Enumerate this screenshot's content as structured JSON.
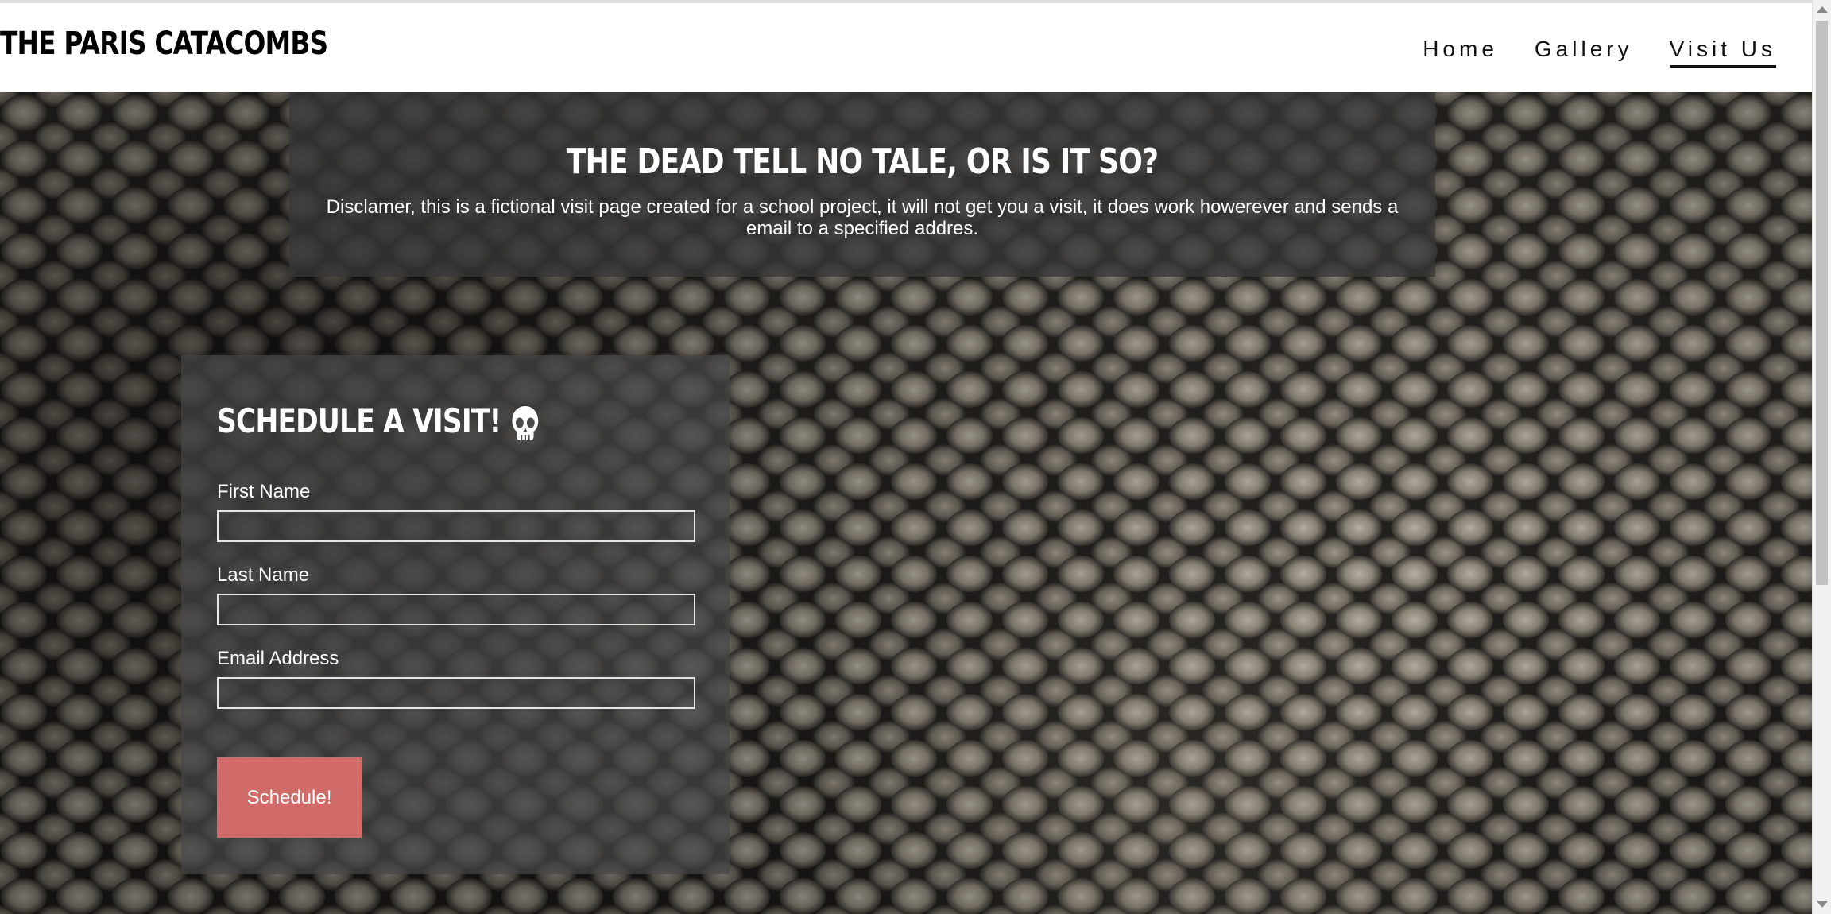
{
  "site": {
    "brand": "THE PARIS CATACOMBS"
  },
  "nav": {
    "items": [
      {
        "label": "Home",
        "active": false
      },
      {
        "label": "Gallery",
        "active": false
      },
      {
        "label": "Visit Us",
        "active": true
      }
    ]
  },
  "intro": {
    "title": "THE DEAD TELL NO TALE, OR IS IT SO?",
    "text": "Disclamer, this is a fictional visit page created for a school project, it will not get you a visit, it does work howerever and sends a email to a specified addres."
  },
  "form": {
    "title": "SCHEDULE A VISIT!",
    "title_icon": "skull-icon",
    "fields": [
      {
        "label": "First Name",
        "value": "",
        "placeholder": ""
      },
      {
        "label": "Last Name",
        "value": "",
        "placeholder": ""
      },
      {
        "label": "Email Address",
        "value": "",
        "placeholder": ""
      }
    ],
    "submit_label": "Schedule!"
  },
  "colors": {
    "submit_button": "#d06b69",
    "panel_overlay": "#373737",
    "header_bg": "#ffffff"
  },
  "icons": {
    "scroll_up": "triangle-up-icon",
    "scroll_down": "triangle-down-icon"
  }
}
